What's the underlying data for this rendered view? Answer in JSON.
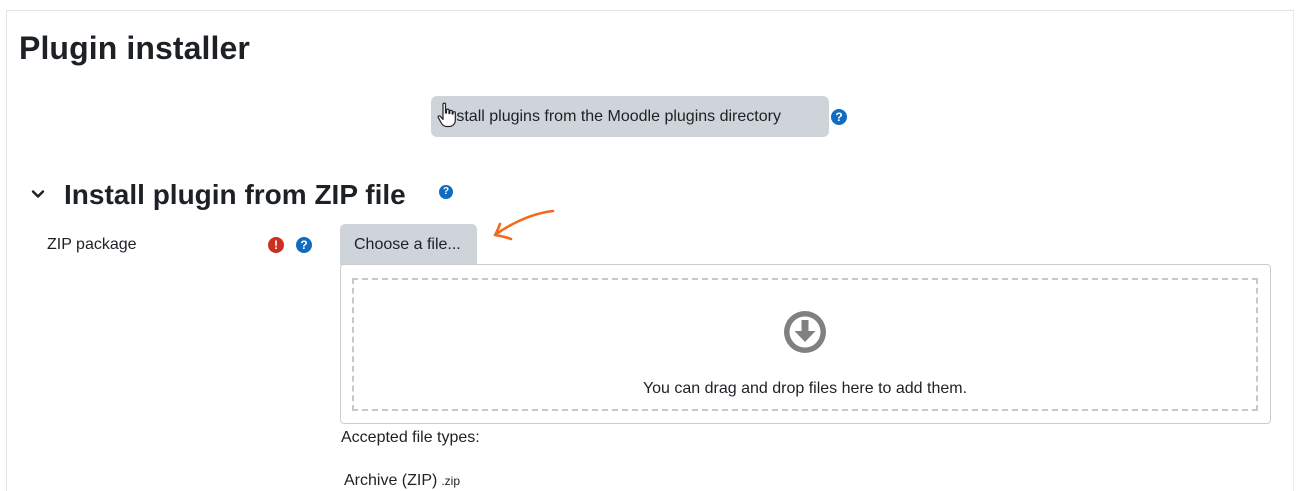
{
  "page": {
    "title": "Plugin installer"
  },
  "directory_button": {
    "label": "Install plugins from the Moodle plugins directory"
  },
  "section": {
    "heading": "Install plugin from ZIP file"
  },
  "zip_field": {
    "label": "ZIP package",
    "choose_button_label": "Choose a file...",
    "dropzone_text": "You can drag and drop files here to add them.",
    "accepted_label": "Accepted file types:",
    "filetype_name": "Archive (ZIP)",
    "filetype_ext": ".zip"
  },
  "icons": {
    "help": "question-circle-icon",
    "required": "exclamation-circle-icon",
    "collapse": "chevron-down-icon",
    "download": "arrow-circle-down-icon",
    "cursor": "hand-pointer-icon",
    "annotation": "arrow-annotation"
  },
  "colors": {
    "button_bg": "#ced4da",
    "help_blue": "#0f6cbf",
    "required_red": "#ca3120",
    "annotation_orange": "#f26a1b",
    "text": "#1d2125"
  }
}
